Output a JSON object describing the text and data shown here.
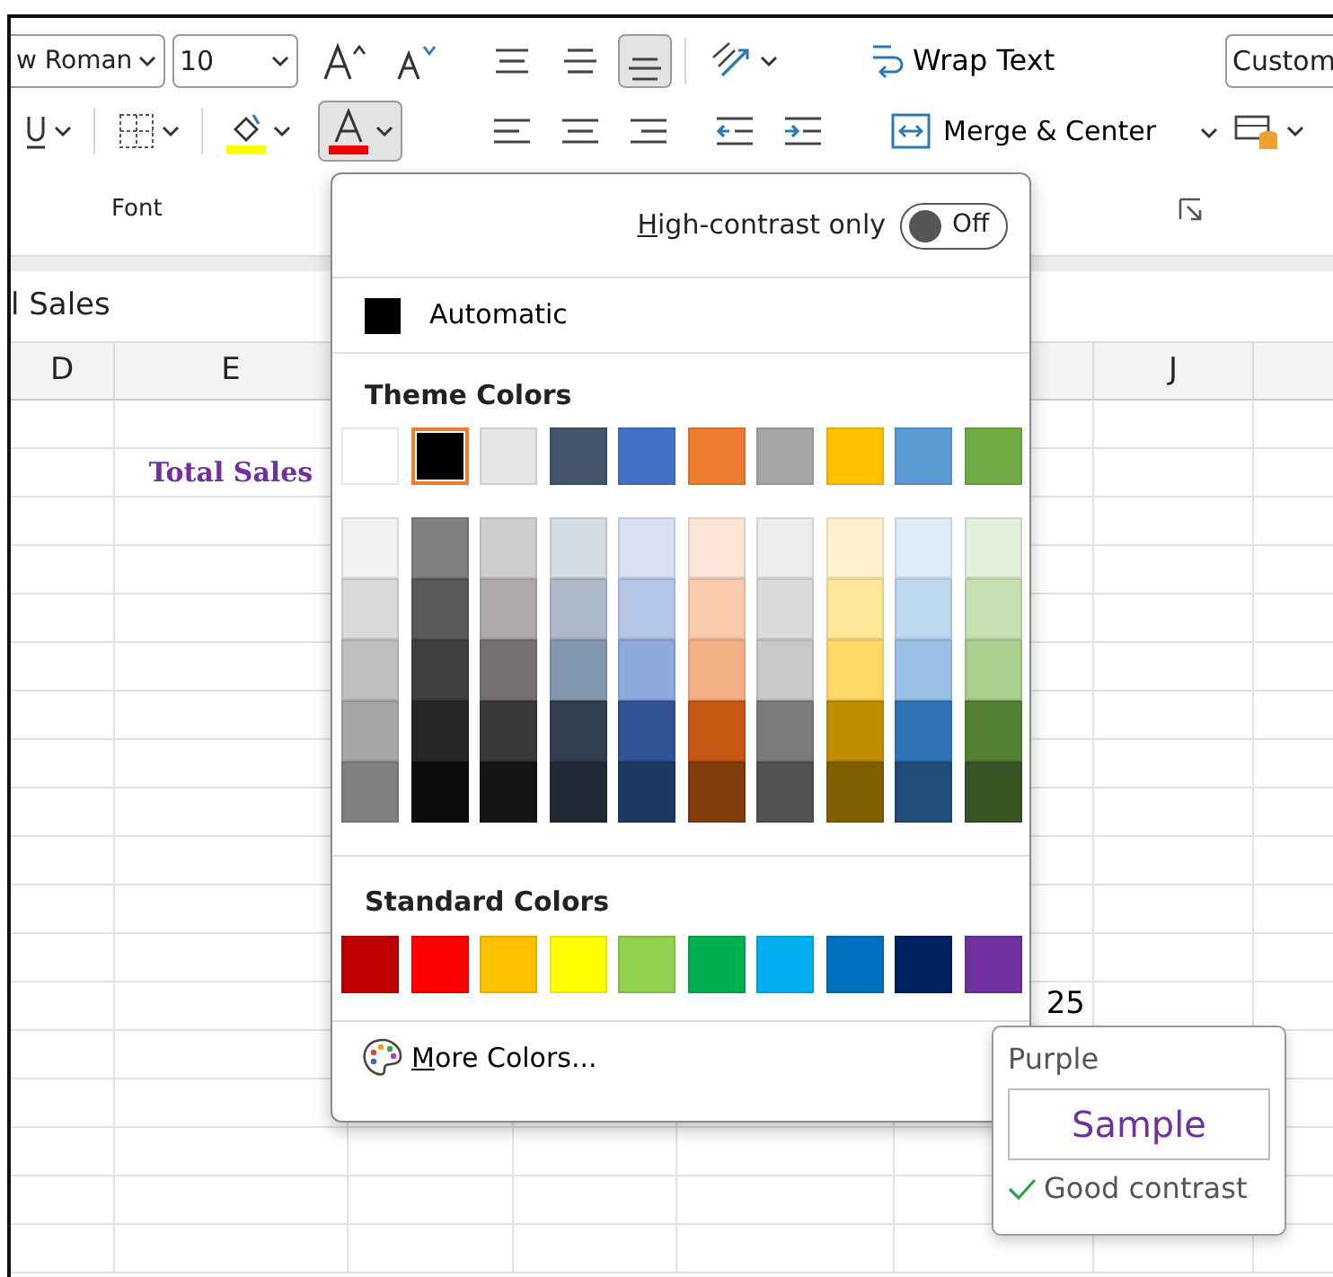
{
  "ribbon": {
    "font_name": "w Roman",
    "font_size": "10",
    "wrap_text": "Wrap Text",
    "merge": "Merge & Center",
    "number_format": "Custom",
    "group_label": "Font",
    "align_bottom_selected": true,
    "font_color_open": true
  },
  "formula_bar": {
    "text": "l Sales"
  },
  "sheet": {
    "columns": [
      {
        "label": "D"
      },
      {
        "label": "E"
      },
      {
        "label": "J"
      }
    ],
    "cells": [
      {
        "text": "Total Sales",
        "color": "#7030a0"
      },
      {
        "text": "25",
        "color": "#000000"
      }
    ]
  },
  "color_menu": {
    "high_contrast": {
      "label": "High-contrast only",
      "toggle_text": "Off",
      "on": false
    },
    "automatic": {
      "label": "Automatic",
      "color": "#000000"
    },
    "theme_title": "Theme Colors",
    "theme_colors": [
      {
        "color": "#ffffff",
        "selected": false,
        "shades": [
          {
            "color": "#f2f2f2"
          },
          {
            "color": "#d9d9d9"
          },
          {
            "color": "#bfbfbf"
          },
          {
            "color": "#a6a6a6"
          },
          {
            "color": "#808080"
          }
        ]
      },
      {
        "color": "#000000",
        "selected": true,
        "shades": [
          {
            "color": "#808080"
          },
          {
            "color": "#595959"
          },
          {
            "color": "#404040"
          },
          {
            "color": "#262626"
          },
          {
            "color": "#0d0d0d"
          }
        ]
      },
      {
        "color": "#e7e6e6",
        "selected": false,
        "shades": [
          {
            "color": "#d0cece"
          },
          {
            "color": "#aeaaaa"
          },
          {
            "color": "#757171"
          },
          {
            "color": "#3a3838"
          },
          {
            "color": "#161616"
          }
        ]
      },
      {
        "color": "#44546a",
        "selected": false,
        "shades": [
          {
            "color": "#d6dce4"
          },
          {
            "color": "#adb9ca"
          },
          {
            "color": "#8497b0"
          },
          {
            "color": "#333f4f"
          },
          {
            "color": "#222b35"
          }
        ]
      },
      {
        "color": "#4472c4",
        "selected": false,
        "shades": [
          {
            "color": "#d9e1f2"
          },
          {
            "color": "#b4c6e7"
          },
          {
            "color": "#8ea9db"
          },
          {
            "color": "#305496"
          },
          {
            "color": "#203764"
          }
        ]
      },
      {
        "color": "#ed7d31",
        "selected": false,
        "shades": [
          {
            "color": "#fce4d6"
          },
          {
            "color": "#f8cbad"
          },
          {
            "color": "#f4b084"
          },
          {
            "color": "#c65911"
          },
          {
            "color": "#833c0c"
          }
        ]
      },
      {
        "color": "#a5a5a5",
        "selected": false,
        "shades": [
          {
            "color": "#ededed"
          },
          {
            "color": "#dbdbdb"
          },
          {
            "color": "#c9c9c9"
          },
          {
            "color": "#7b7b7b"
          },
          {
            "color": "#525252"
          }
        ]
      },
      {
        "color": "#ffc000",
        "selected": false,
        "shades": [
          {
            "color": "#fff2cc"
          },
          {
            "color": "#ffe699"
          },
          {
            "color": "#ffd966"
          },
          {
            "color": "#bf8f00"
          },
          {
            "color": "#806000"
          }
        ]
      },
      {
        "color": "#5b9bd5",
        "selected": false,
        "shades": [
          {
            "color": "#ddebf7"
          },
          {
            "color": "#bdd7ee"
          },
          {
            "color": "#9bc2e6"
          },
          {
            "color": "#2f75b5"
          },
          {
            "color": "#1f4e78"
          }
        ]
      },
      {
        "color": "#70ad47",
        "selected": false,
        "shades": [
          {
            "color": "#e2efda"
          },
          {
            "color": "#c6e0b4"
          },
          {
            "color": "#a9d08e"
          },
          {
            "color": "#548235"
          },
          {
            "color": "#375623"
          }
        ]
      }
    ],
    "standard_title": "Standard Colors",
    "standard_colors": [
      {
        "color": "#c00000"
      },
      {
        "color": "#ff0000"
      },
      {
        "color": "#ffc000"
      },
      {
        "color": "#ffff00"
      },
      {
        "color": "#92d050"
      },
      {
        "color": "#00b050"
      },
      {
        "color": "#00b0f0"
      },
      {
        "color": "#0070c0"
      },
      {
        "color": "#002060"
      },
      {
        "color": "#7030a0"
      }
    ],
    "more_colors": "More Colors..."
  },
  "tooltip": {
    "name": "Purple",
    "sample": "Sample",
    "contrast": "Good contrast"
  }
}
